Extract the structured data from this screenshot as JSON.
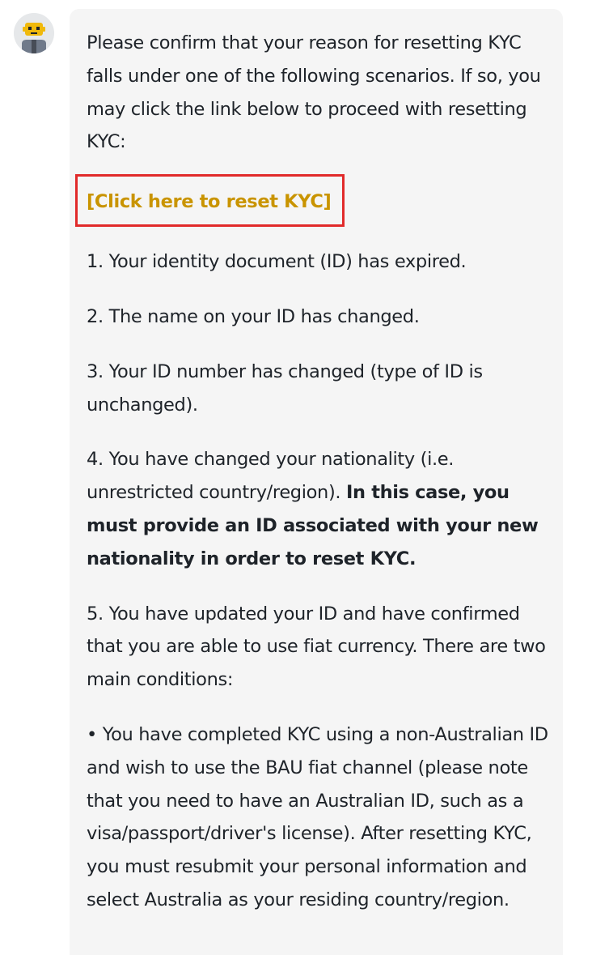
{
  "assistant": {
    "avatar_icon": "robot-avatar-icon"
  },
  "message": {
    "intro": "Please confirm that your reason for resetting KYC falls under one of the following scenarios. If so, you may click the link below to proceed with resetting KYC:",
    "link_label": "[Click here to reset KYC]",
    "item1": "1. Your identity document (ID) has expired.",
    "item2": "2. The name on your ID has changed.",
    "item3": "3. Your ID number has changed (type of ID is unchanged).",
    "item4_normal": "4. You have changed your nationality (i.e. unrestricted country/region). ",
    "item4_bold": "In this case, you must provide an ID associated with your new nationality in order to reset KYC.",
    "item5": "5. You have updated your ID and have confirmed that you are able to use fiat currency. There are two main conditions:",
    "bullet1": "• You have completed KYC using a non-Australian ID and wish to use the BAU fiat channel (please note that you need to have an Australian ID, such as a visa/passport/driver's license). After resetting KYC, you must resubmit your personal information and select Australia as your residing country/region."
  },
  "colors": {
    "link": "#c99400",
    "highlight_border": "#e12a2a",
    "bubble_bg": "#f5f5f5",
    "text": "#1e2329"
  }
}
